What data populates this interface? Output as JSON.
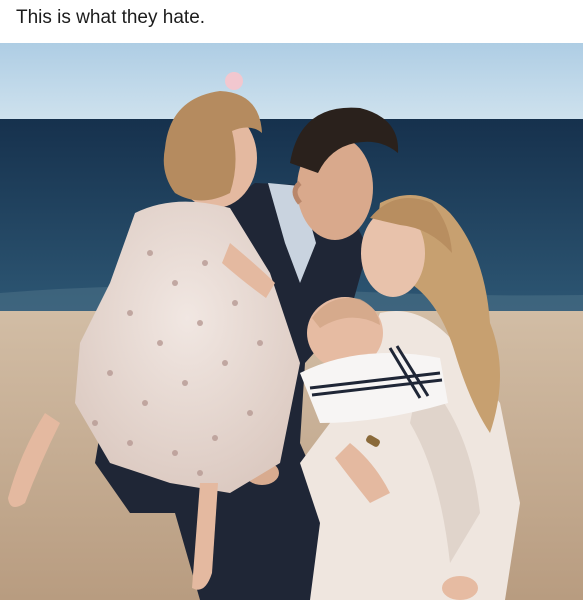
{
  "post": {
    "caption": "This is what they hate."
  },
  "photo": {
    "alt": "A family on a beach: a man kissing a woman while holding a toddler in a floral tulle dress, the woman holding a baby in a sailor outfit",
    "colors": {
      "sky": "#b9d6ea",
      "sea": "#1e3e5c",
      "sand": "#c8b39a",
      "suit": "#1f2636",
      "dress": "#e9ddd6",
      "womans_blouse": "#efe6df",
      "hair_blonde": "#c7a070",
      "hair_dark": "#2a211c",
      "skin": "#e4b9a0"
    }
  }
}
